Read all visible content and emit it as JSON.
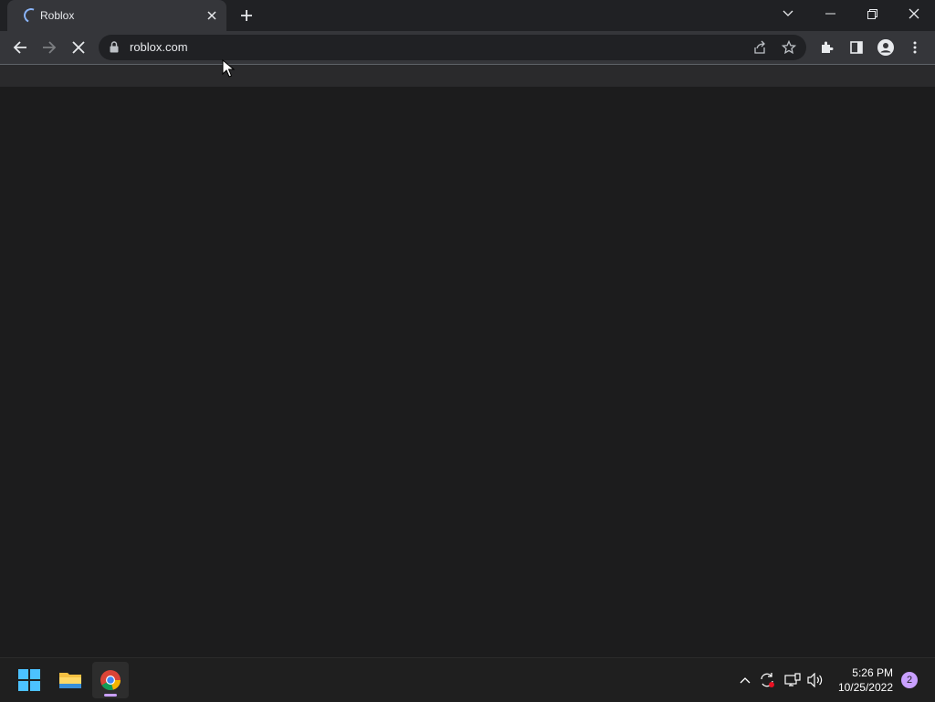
{
  "browser": {
    "tab": {
      "title": "Roblox",
      "loading": true
    },
    "omnibox": {
      "url": "roblox.com"
    },
    "colors": {
      "frame": "#202124",
      "toolbar": "#35363a",
      "content": "#1c1c1d",
      "accent": "#8ab4f8"
    }
  },
  "taskbar": {
    "apps": [
      {
        "icon": "windows-start-icon"
      },
      {
        "icon": "file-explorer-icon"
      },
      {
        "icon": "chrome-icon",
        "active": true
      }
    ],
    "clock": {
      "time": "5:26 PM",
      "date": "10/25/2022"
    },
    "notification_count": "2"
  }
}
